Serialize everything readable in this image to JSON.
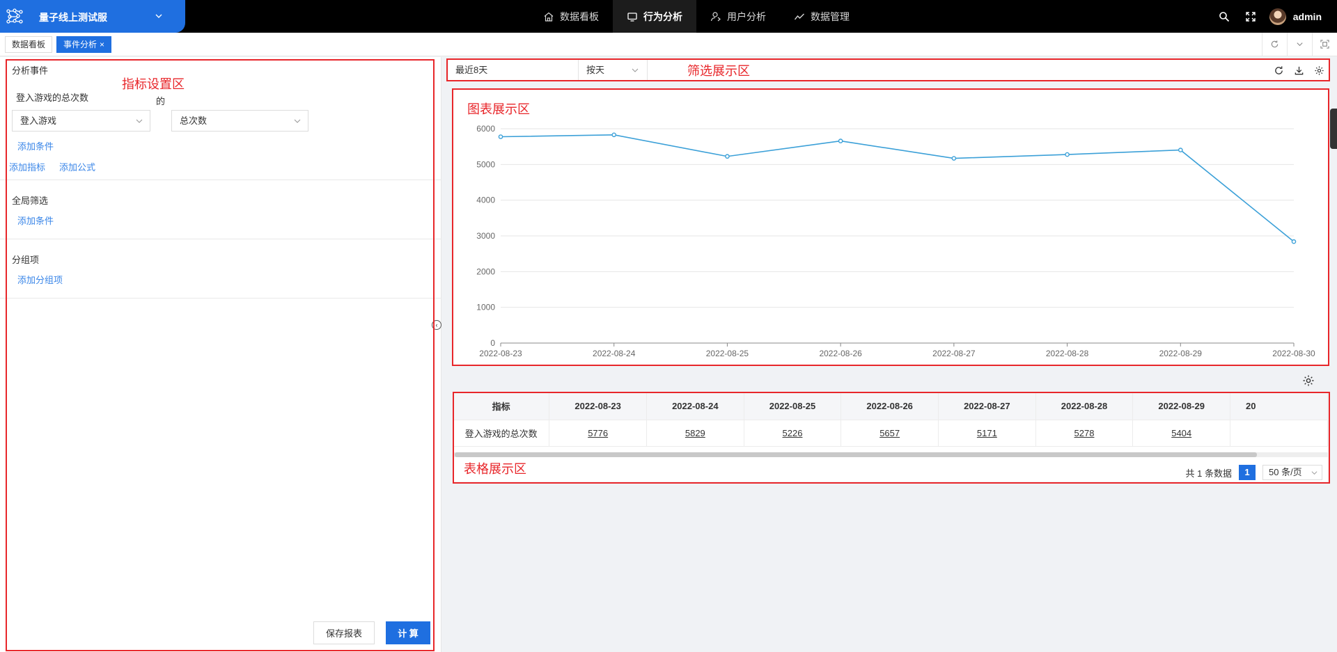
{
  "brand": {
    "title": "量子线上测试服"
  },
  "nav": [
    {
      "label": "数据看板",
      "icon": "home-icon",
      "active": false
    },
    {
      "label": "行为分析",
      "icon": "monitor-icon",
      "active": true
    },
    {
      "label": "用户分析",
      "icon": "user-icon",
      "active": false
    },
    {
      "label": "数据管理",
      "icon": "trend-icon",
      "active": false
    }
  ],
  "user": {
    "name": "admin"
  },
  "tabs": [
    {
      "label": "数据看板"
    },
    {
      "label": "事件分析",
      "close": "×"
    }
  ],
  "left": {
    "analysis_event_title": "分析事件",
    "metric_name": "登入游戏的总次数",
    "event_select": "登入游戏",
    "of_label": "的",
    "measure_select": "总次数",
    "add_condition": "添加条件",
    "add_metric": "添加指标",
    "add_formula": "添加公式",
    "global_filter_title": "全局筛选",
    "global_add_condition": "添加条件",
    "group_title": "分组项",
    "add_group": "添加分组项",
    "save_button": "保存报表",
    "compute_button": "计 算"
  },
  "filter": {
    "date_range": "最近8天",
    "granularity": "按天"
  },
  "annotations": {
    "metric_area": "指标设置区",
    "filter_area": "筛选展示区",
    "chart_area": "图表展示区",
    "table_area": "表格展示区"
  },
  "chart_data": {
    "type": "line",
    "x": [
      "2022-08-23",
      "2022-08-24",
      "2022-08-25",
      "2022-08-26",
      "2022-08-27",
      "2022-08-28",
      "2022-08-29",
      "2022-08-30"
    ],
    "series": [
      {
        "values": [
          5776,
          5829,
          5226,
          5657,
          5171,
          5278,
          5404,
          2840
        ]
      }
    ],
    "ylim": [
      0,
      6000
    ],
    "yticks": [
      0,
      1000,
      2000,
      3000,
      4000,
      5000,
      6000
    ],
    "grid": true,
    "color": "#3ba0d8"
  },
  "table": {
    "header_label": "指标",
    "columns": [
      "2022-08-23",
      "2022-08-24",
      "2022-08-25",
      "2022-08-26",
      "2022-08-27",
      "2022-08-28",
      "2022-08-29",
      "20"
    ],
    "rows": [
      {
        "name": "登入游戏的总次数",
        "values": [
          "5776",
          "5829",
          "5226",
          "5657",
          "5171",
          "5278",
          "5404",
          ""
        ]
      }
    ]
  },
  "pager": {
    "total": "共 1 条数据",
    "page": "1",
    "page_size": "50 条/页"
  },
  "colors": {
    "primary": "#1f6fe0",
    "annotation": "#e8262a",
    "link": "#3a86e8"
  }
}
